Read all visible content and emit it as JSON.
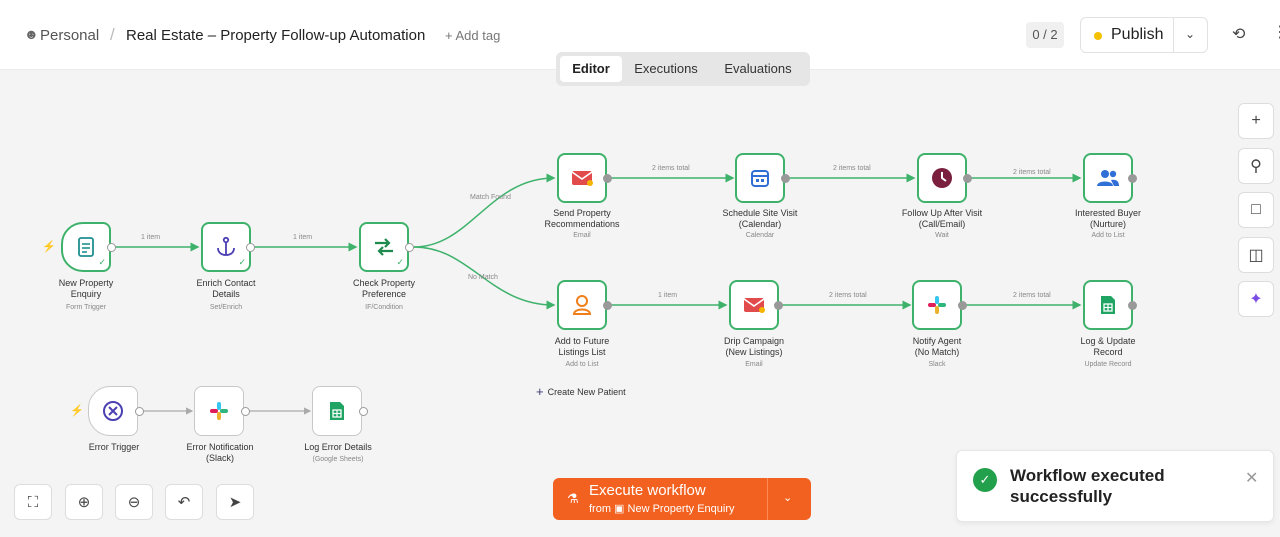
{
  "header": {
    "workspace": "Personal",
    "separator": "/",
    "workflow_title": "Real Estate – Property Follow-up Automation",
    "add_tag": "+ Add tag",
    "counter": "0 / 2",
    "publish_label": "Publish"
  },
  "tabs": [
    "Editor",
    "Executions",
    "Evaluations"
  ],
  "active_tab": "Editor",
  "nodes": {
    "new_property_enquiry": {
      "label": "New Property\nEnquiry",
      "sub": "Form Trigger"
    },
    "enrich_contact_details": {
      "label": "Enrich Contact\nDetails",
      "sub": "Set/Enrich"
    },
    "check_property_preference": {
      "label": "Check Property\nPreference",
      "sub": "IF/Condition"
    },
    "send_property_recommendations": {
      "label": "Send Property\nRecommendations",
      "sub": "Email"
    },
    "schedule_site_visit": {
      "label": "Schedule Site Visit\n(Calendar)",
      "sub": "Calendar"
    },
    "follow_up_after_visit": {
      "label": "Follow Up After Visit\n(Call/Email)",
      "sub": "Wait"
    },
    "interested_buyer": {
      "label": "Interested Buyer\n(Nurture)",
      "sub": "Add to List"
    },
    "add_to_future_listings": {
      "label": "Add to Future\nListings List",
      "sub": "Add to List"
    },
    "drip_campaign": {
      "label": "Drip Campaign\n(New Listings)",
      "sub": "Email"
    },
    "notify_agent": {
      "label": "Notify Agent\n(No Match)",
      "sub": "Slack"
    },
    "log_update_record": {
      "label": "Log & Update\nRecord",
      "sub": "Update Record"
    },
    "error_trigger": {
      "label": "Error Trigger",
      "sub": ""
    },
    "error_notification": {
      "label": "Error Notification\n(Slack)",
      "sub": ""
    },
    "log_error_details": {
      "label": "Log Error Details",
      "sub": "(Google Sheets)"
    }
  },
  "edge_labels": {
    "e1": "1 item",
    "e2": "1 item",
    "match_found": "Match Found",
    "no_match": "No Match",
    "top1": "2 items total",
    "top2": "2 items total",
    "top3": "2 items total",
    "bot1": "1 item",
    "bot2": "2 items total",
    "bot3": "2 items total"
  },
  "create_new": "Create New Patient",
  "execute": {
    "label": "Execute workflow",
    "from": "from",
    "trigger_name": "New Property Enquiry"
  },
  "toast": {
    "message": "Workflow executed successfully"
  },
  "icons": {
    "new_property_enquiry": "form-icon",
    "enrich_contact_details": "anchor-icon",
    "check_property_preference": "branch-icon",
    "send_property_recommendations": "mail-icon",
    "schedule_site_visit": "calendar-icon",
    "follow_up_after_visit": "clock-icon",
    "interested_buyer": "users-icon",
    "add_to_future_listings": "user-icon",
    "drip_campaign": "mail-icon",
    "notify_agent": "slack-icon",
    "log_update_record": "sheets-icon",
    "error_trigger": "x-circle-icon",
    "error_notification": "slack-icon",
    "log_error_details": "sheets-icon"
  },
  "colors": {
    "success_green": "#3eb26b",
    "execute_orange": "#f2611f",
    "publish_dot": "#f5c000"
  }
}
